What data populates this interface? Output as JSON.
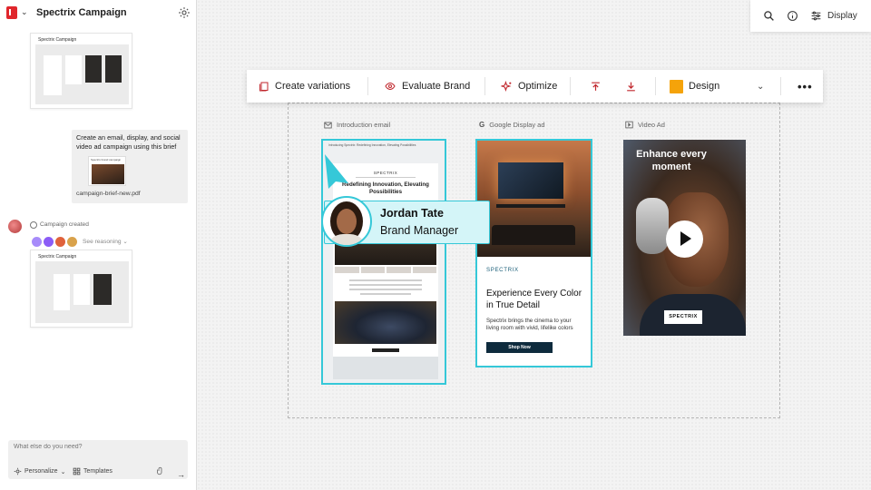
{
  "sidebar": {
    "title": "Spectrix Campaign",
    "thumb1_title": "Spectrix Campaign",
    "message": "Create an email, display, and social video ad campaign using this brief",
    "brief_thumb_title": "Spectrix brand campaign",
    "brief_file": "campaign-brief-new.pdf",
    "status": "Campaign created",
    "see_reasoning": "See reasoning",
    "thumb2_title": "Spectrix Campaign",
    "input_placeholder": "What else do you need?",
    "personalize_label": "Personalize",
    "templates_label": "Templates",
    "agent_colors": [
      "#a78bfa",
      "#8b5cf6",
      "#e0623b",
      "#d9a24b"
    ]
  },
  "topbar": {
    "display_label": "Display"
  },
  "toolbar": {
    "create_variations": "Create variations",
    "evaluate_brand": "Evaluate Brand",
    "optimize": "Optimize",
    "design_label": "Design",
    "design_color": "#f5a30a"
  },
  "columns": {
    "email_label": "Introduction email",
    "display_label": "Google Display ad",
    "video_label": "Video Ad"
  },
  "email": {
    "header_lines": "Introducing Spectrix: Redefining Innovation, Elevating Possibilities",
    "brand": "SPECTRIX",
    "headline": "Redefining Innovation, Elevating Possibilities"
  },
  "display_ad": {
    "brand": "SPECTRIX",
    "headline": "Experience Every Color in True Detail",
    "subtext": "Spectrix brings the cinema to your living room with vivid, lifelike colors",
    "cta": "Shop Now"
  },
  "video_ad": {
    "headline": "Enhance every moment",
    "brand": "SPECTRIX"
  },
  "collaborator": {
    "name": "Jordan Tate",
    "role": "Brand Manager"
  },
  "colors": {
    "accent": "#35c8d8",
    "logo": "#e0262c"
  }
}
